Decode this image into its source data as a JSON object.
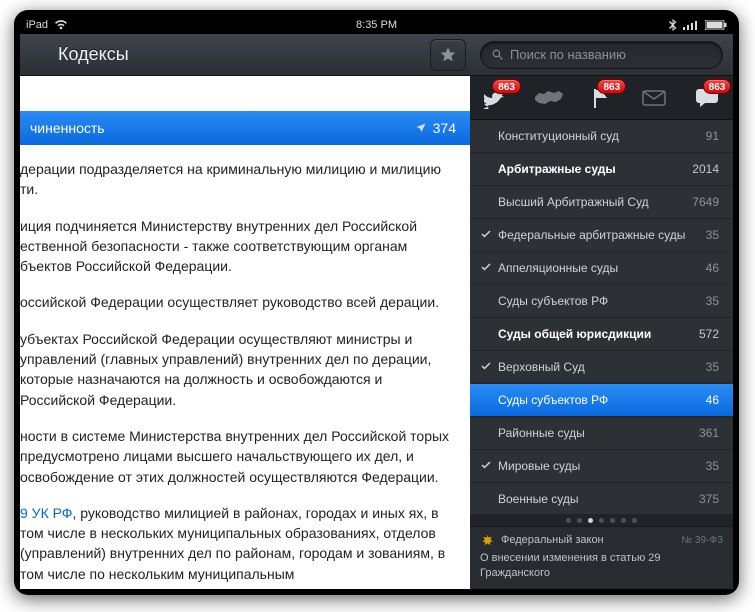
{
  "statusbar": {
    "device": "iPad",
    "time": "8:35 PM"
  },
  "header": {
    "title": "Кодексы"
  },
  "banner": {
    "label": "чиненность",
    "count": "374"
  },
  "doc": {
    "p1": "дерации подразделяется на криминальную милицию и милицию ти.",
    "p2": "иция подчиняется Министерству внутренних дел Российской ественной безопасности - также соответствующим органам бъектов Российской Федерации.",
    "p3": "оссийской Федерации осуществляет руководство всей дерации.",
    "p4": "убъектах Российской Федерации осуществляют министры и управлений (главных управлений) внутренних дел по дерации, которые назначаются на должность и освобождаются и Российской Федерации.",
    "p5": "ности в системе Министерства внутренних дел Российской торых предусмотрено лицами высшего начальствующего их дел, и освобождение от этих должностей осуществляются Федерации.",
    "p6_link": "9 УК РФ",
    "p6_rest": ", руководство милицией в районах, городах и иных ях, в том числе в нескольких муниципальных образованиях, отделов (управлений) внутренних дел по районам, городам и зованиям, в том числе по нескольким муниципальным"
  },
  "search": {
    "placeholder": "Поиск по названию"
  },
  "tabs": {
    "badge": "863"
  },
  "courts": [
    {
      "label": "Конституционный суд",
      "num": "91",
      "bold": false,
      "check": false,
      "selected": false
    },
    {
      "label": "Арбитражные суды",
      "num": "2014",
      "bold": true,
      "check": false,
      "selected": false
    },
    {
      "label": "Высший Арбитражный Суд",
      "num": "7649",
      "bold": false,
      "check": false,
      "selected": false
    },
    {
      "label": "Федеральные арбитражные суды",
      "num": "35",
      "bold": false,
      "check": true,
      "selected": false
    },
    {
      "label": "Аппеляционные суды",
      "num": "46",
      "bold": false,
      "check": true,
      "selected": false
    },
    {
      "label": "Суды субъектов РФ",
      "num": "35",
      "bold": false,
      "check": false,
      "selected": false
    },
    {
      "label": "Суды общей юрисдикции",
      "num": "572",
      "bold": true,
      "check": false,
      "selected": false
    },
    {
      "label": "Верховный Суд",
      "num": "35",
      "bold": false,
      "check": true,
      "selected": false
    },
    {
      "label": "Суды субъектов РФ",
      "num": "46",
      "bold": false,
      "check": false,
      "selected": true
    },
    {
      "label": "Районные суды",
      "num": "361",
      "bold": false,
      "check": false,
      "selected": false
    },
    {
      "label": "Мировые суды",
      "num": "35",
      "bold": false,
      "check": true,
      "selected": false
    },
    {
      "label": "Военные суды",
      "num": "375",
      "bold": false,
      "check": false,
      "selected": false
    }
  ],
  "footer": {
    "type": "Федеральный закон",
    "ref": "№ 39-ФЗ",
    "desc": "О внесении изменения в статью 29 Гражданского"
  }
}
